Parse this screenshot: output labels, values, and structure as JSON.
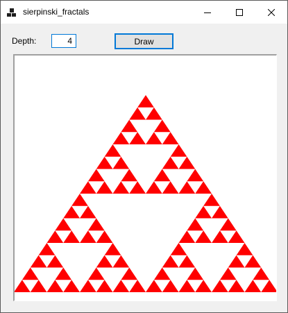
{
  "window": {
    "title": "sierpinski_fractals",
    "icons": {
      "app": "app-icon",
      "minimize": "minimize-icon",
      "maximize": "maximize-icon",
      "close": "close-icon"
    }
  },
  "controls": {
    "depth_label": "Depth:",
    "depth_value": "4",
    "draw_label": "Draw"
  },
  "fractal": {
    "type": "sierpinski-triangle",
    "depth": 4,
    "fill_color": "#ff0000",
    "background_color": "#ffffff"
  }
}
